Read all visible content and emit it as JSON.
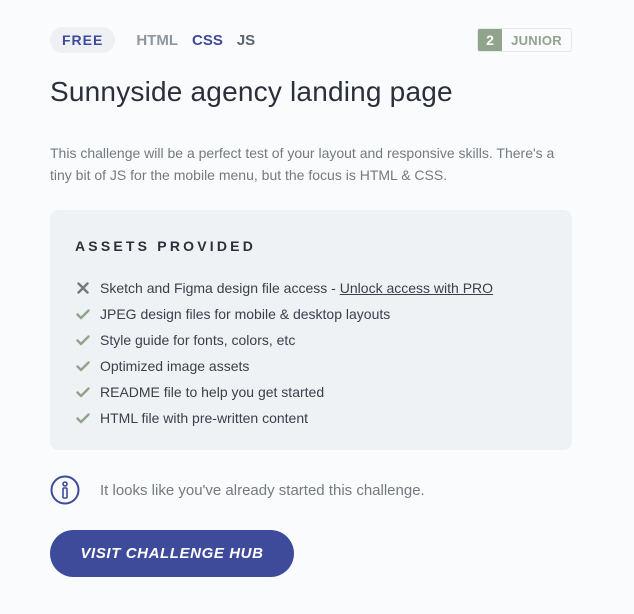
{
  "header": {
    "price_badge": "FREE",
    "tags": [
      "HTML",
      "CSS",
      "JS"
    ],
    "level": {
      "number": "2",
      "name": "JUNIOR"
    }
  },
  "title": "Sunnyside agency landing page",
  "description": "This challenge will be a perfect test of your layout and responsive skills. There's a tiny bit of JS for the mobile menu, but the focus is HTML & CSS.",
  "assets": {
    "heading": "ASSETS PROVIDED",
    "items": [
      {
        "label": "Sketch and Figma design file access - ",
        "link": "Unlock access with PRO",
        "icon": "cross-icon"
      },
      {
        "label": "JPEG design files for mobile & desktop layouts",
        "icon": "check-icon"
      },
      {
        "label": "Style guide for fonts, colors, etc",
        "icon": "check-icon"
      },
      {
        "label": "Optimized image assets",
        "icon": "check-icon"
      },
      {
        "label": "README file to help you get started",
        "icon": "check-icon"
      },
      {
        "label": "HTML file with pre-written content",
        "icon": "check-icon"
      }
    ]
  },
  "notice": {
    "text": "It looks like you've already started this challenge.",
    "icon": "info-icon"
  },
  "cta": {
    "label": "VISIT CHALLENGE HUB"
  },
  "colors": {
    "brand": "#3e4b9b",
    "junior": "#8fa48a",
    "check": "#8fa48a",
    "cross": "#737a80"
  }
}
